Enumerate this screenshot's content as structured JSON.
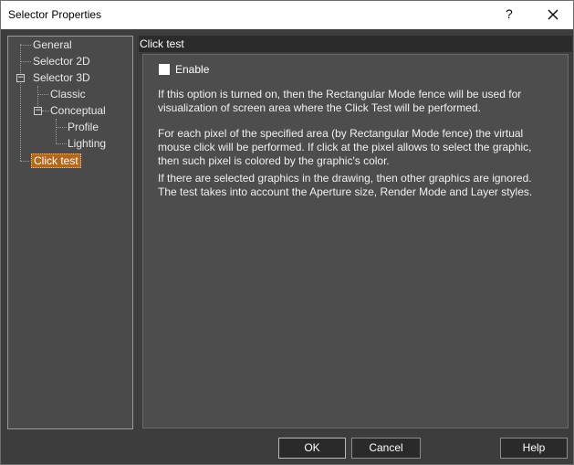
{
  "window": {
    "title": "Selector Properties",
    "help_glyph": "?",
    "close_icon": "close-icon"
  },
  "tree": {
    "items": [
      {
        "label": "General"
      },
      {
        "label": "Selector 2D"
      },
      {
        "label": "Selector 3D",
        "expanded": true
      },
      {
        "label": "Classic"
      },
      {
        "label": "Conceptual",
        "expanded": true
      },
      {
        "label": "Profile"
      },
      {
        "label": "Lighting"
      },
      {
        "label": "Click test",
        "selected": true
      }
    ],
    "collapse_glyph": "−"
  },
  "panel": {
    "header": "Click test",
    "enable_label": "Enable",
    "enable_checked": false,
    "paragraphs": [
      "If this option is turned on, then the Rectangular Mode fence will be used for visualization of screen area where the Click Test will be performed.",
      "For each pixel of the specified area (by Rectangular Mode fence) the virtual mouse click will be performed. If click at the pixel allows to select the graphic, then such pixel is colored by the graphic's color.",
      "If there are selected graphics in the drawing, then other graphics are ignored. The test takes into account the Aperture size, Render Mode and Layer styles."
    ]
  },
  "buttons": {
    "ok": "OK",
    "cancel": "Cancel",
    "help": "Help"
  },
  "colors": {
    "background": "#3d3d3d",
    "selection": "#b4661b",
    "header": "#2b2b2b"
  }
}
